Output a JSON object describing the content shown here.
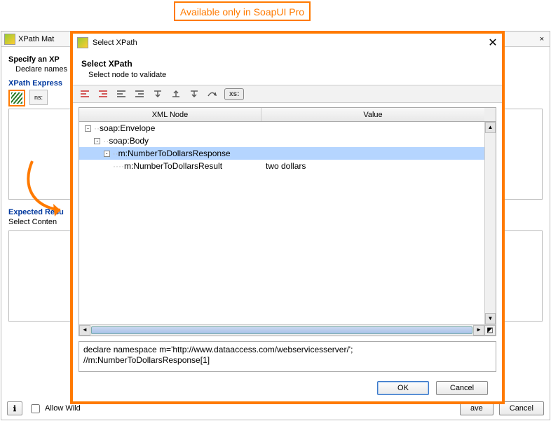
{
  "annotation": "Available only in SoapUI Pro",
  "parent": {
    "title": "XPath Mat",
    "heading": "Specify an XP",
    "subheading": "Declare names",
    "expr_label": "XPath Express",
    "ns_btn": "ns:",
    "expected_label": "Expected Resu",
    "expected_sub": "Select Conten",
    "allow_wild": "Allow Wild",
    "save": "ave",
    "cancel": "Cancel"
  },
  "modal": {
    "title": "Select XPath",
    "heading": "Select XPath",
    "subheading": "Select node to validate",
    "xs_label": "xs:",
    "cols": {
      "c1": "XML Node",
      "c2": "Value"
    },
    "tree": [
      {
        "indent": 0,
        "toggle": "-",
        "label": "soap:Envelope",
        "value": "",
        "selected": false
      },
      {
        "indent": 1,
        "toggle": "-",
        "label": "soap:Body",
        "value": "",
        "selected": false
      },
      {
        "indent": 2,
        "toggle": "-",
        "label": "m:NumberToDollarsResponse",
        "value": "",
        "selected": true
      },
      {
        "indent": 3,
        "toggle": "",
        "label": "m:NumberToDollarsResult",
        "value": "two dollars",
        "selected": false
      }
    ],
    "xpath_output": "declare namespace m='http://www.dataaccess.com/webservicesserver/';\n//m:NumberToDollarsResponse[1]",
    "ok": "OK",
    "cancel": "Cancel"
  }
}
